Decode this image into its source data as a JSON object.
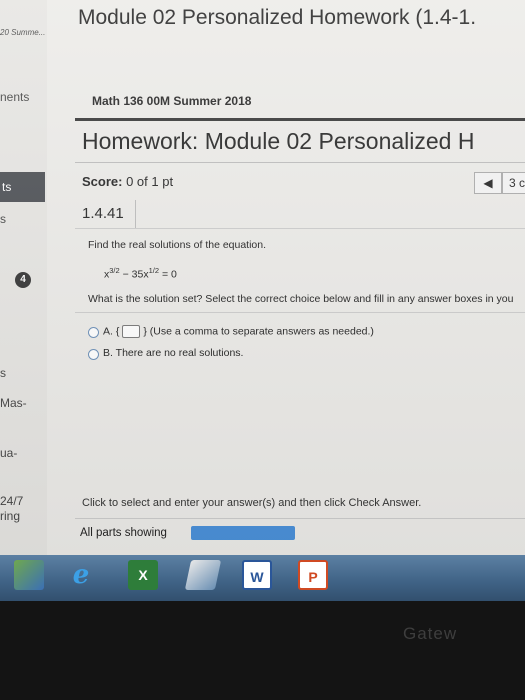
{
  "sidebar": {
    "top_text": "20 Summe...",
    "item_assignments": "nents",
    "item_selected": "ts",
    "item_marker": "s",
    "badge_count": "4",
    "item_marker_2": "s",
    "item_mastery": "Mas-",
    "item_qual": "ua-",
    "date_text": "24/7",
    "item_ring": "ring"
  },
  "window": {
    "title": "Module 02 Personalized Homework (1.4-1."
  },
  "course": "Math 136 00M Summer 2018",
  "homework": {
    "title": "Homework: Module 02 Personalized H",
    "score_label": "Score:",
    "score_value": "0 of 1 pt",
    "prev_glyph": "◀",
    "next_label": "3 c",
    "question_number": "1.4.41"
  },
  "question": {
    "prompt": "Find the real solutions of the equation.",
    "eq_x": "x",
    "eq_exp1": "3/2",
    "eq_minus": " − 35x",
    "eq_exp2": "1/2",
    "eq_rhs": " = 0",
    "instruction": "What is the solution set? Select the correct choice below and fill in any answer boxes in you",
    "option_a_label": "A.",
    "option_a_brace_open": "{",
    "option_a_brace_close": "}",
    "option_a_hint": "(Use a comma to separate answers as needed.)",
    "option_b_label": "B.",
    "option_b_text": "There are no real solutions."
  },
  "footer": {
    "click_text": "Click to select and enter your answer(s) and then click Check Answer.",
    "parts_label": "All parts showing"
  },
  "taskbar": {
    "icons": [
      "start-icon",
      "ie-icon",
      "excel-icon",
      "notes-icon",
      "word-icon",
      "powerpoint-icon"
    ],
    "excel_letter": "X",
    "word_letter": "W",
    "ppt_letter": "P"
  },
  "monitor": {
    "brand": "Gatew"
  },
  "colors": {
    "accent": "#4a90d9",
    "taskbar": "#3f6285"
  }
}
